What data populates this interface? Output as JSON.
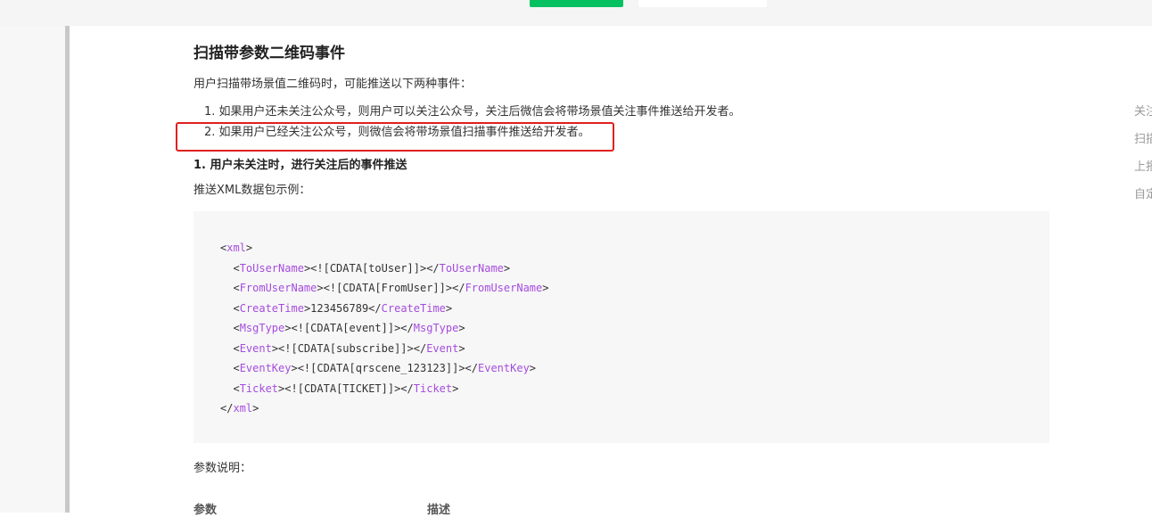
{
  "section": {
    "title": "扫描带参数二维码事件",
    "intro": "用户扫描带场景值二维码时，可能推送以下两种事件：",
    "list": [
      "1. 如果用户还未关注公众号，则用户可以关注公众号，关注后微信会将带场景值关注事件推送给开发者。",
      "2. 如果用户已经关注公众号，则微信会将带场景值扫描事件推送给开发者。"
    ],
    "subheading": "1. 用户未关注时，进行关注后的事件推送",
    "xml_caption": "推送XML数据包示例：",
    "params_caption": "参数说明：",
    "table_headers": [
      "参数",
      "描述"
    ]
  },
  "code": {
    "lines": [
      {
        "pre": "<",
        "tag": "xml",
        "mid": ">",
        "close": "",
        "end": ""
      },
      {
        "pre": "  <",
        "tag": "ToUserName",
        "mid": "><![CDATA[toUser]]></",
        "close": "ToUserName",
        "end": ">"
      },
      {
        "pre": "  <",
        "tag": "FromUserName",
        "mid": "><![CDATA[FromUser]]></",
        "close": "FromUserName",
        "end": ">"
      },
      {
        "pre": "  <",
        "tag": "CreateTime",
        "mid": ">123456789</",
        "close": "CreateTime",
        "end": ">"
      },
      {
        "pre": "  <",
        "tag": "MsgType",
        "mid": "><![CDATA[event]]></",
        "close": "MsgType",
        "end": ">"
      },
      {
        "pre": "  <",
        "tag": "Event",
        "mid": "><![CDATA[subscribe]]></",
        "close": "Event",
        "end": ">"
      },
      {
        "pre": "  <",
        "tag": "EventKey",
        "mid": "><![CDATA[qrscene_123123]]></",
        "close": "EventKey",
        "end": ">"
      },
      {
        "pre": "  <",
        "tag": "Ticket",
        "mid": "><![CDATA[TICKET]]></",
        "close": "Ticket",
        "end": ">"
      },
      {
        "pre": "</",
        "tag": "xml",
        "mid": ">",
        "close": "",
        "end": ""
      }
    ]
  },
  "toc": {
    "items": [
      "关注",
      "扫描",
      "上报",
      "自定"
    ]
  },
  "colors": {
    "tag": "#a54cdf",
    "highlight_border": "#e02020",
    "primary_button": "#07c160"
  }
}
